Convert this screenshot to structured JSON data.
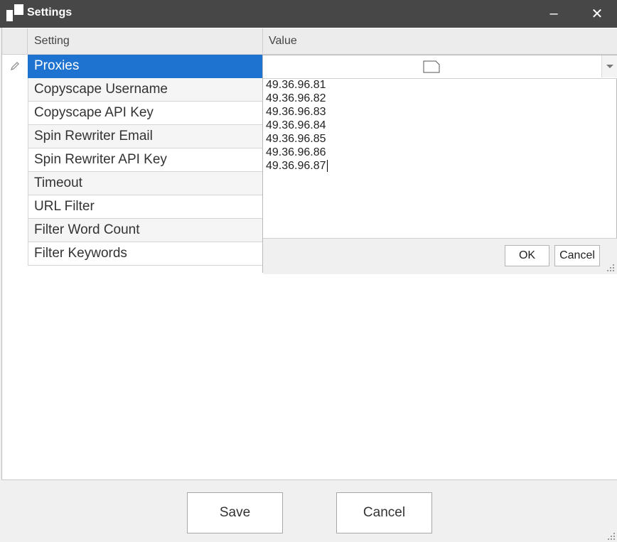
{
  "window": {
    "title": "Settings",
    "minimize_glyph": "–",
    "close_glyph": "✕",
    "icon": "app-icon"
  },
  "grid": {
    "columns": [
      "Setting",
      "Value"
    ],
    "rows": [
      "Proxies",
      "Copyscape Username",
      "Copyscape API Key",
      "Spin Rewriter Email",
      "Spin Rewriter API Key",
      "Timeout",
      "URL Filter",
      "Filter Word Count",
      "Filter Keywords"
    ],
    "selected_row": "Proxies",
    "edit_indicator_icon": "pencil-icon"
  },
  "proxy_editor": {
    "combo_icon": "document-icon",
    "lines": [
      "49.36.96.81",
      "49.36.96.82",
      "49.36.96.83",
      "49.36.96.84",
      "49.36.96.85",
      "49.36.96.86",
      "49.36.96.87"
    ],
    "ok_label": "OK",
    "cancel_label": "Cancel"
  },
  "footer": {
    "save_label": "Save",
    "cancel_label": "Cancel"
  },
  "colors": {
    "titlebar": "#474747",
    "selection": "#1e73d1"
  }
}
